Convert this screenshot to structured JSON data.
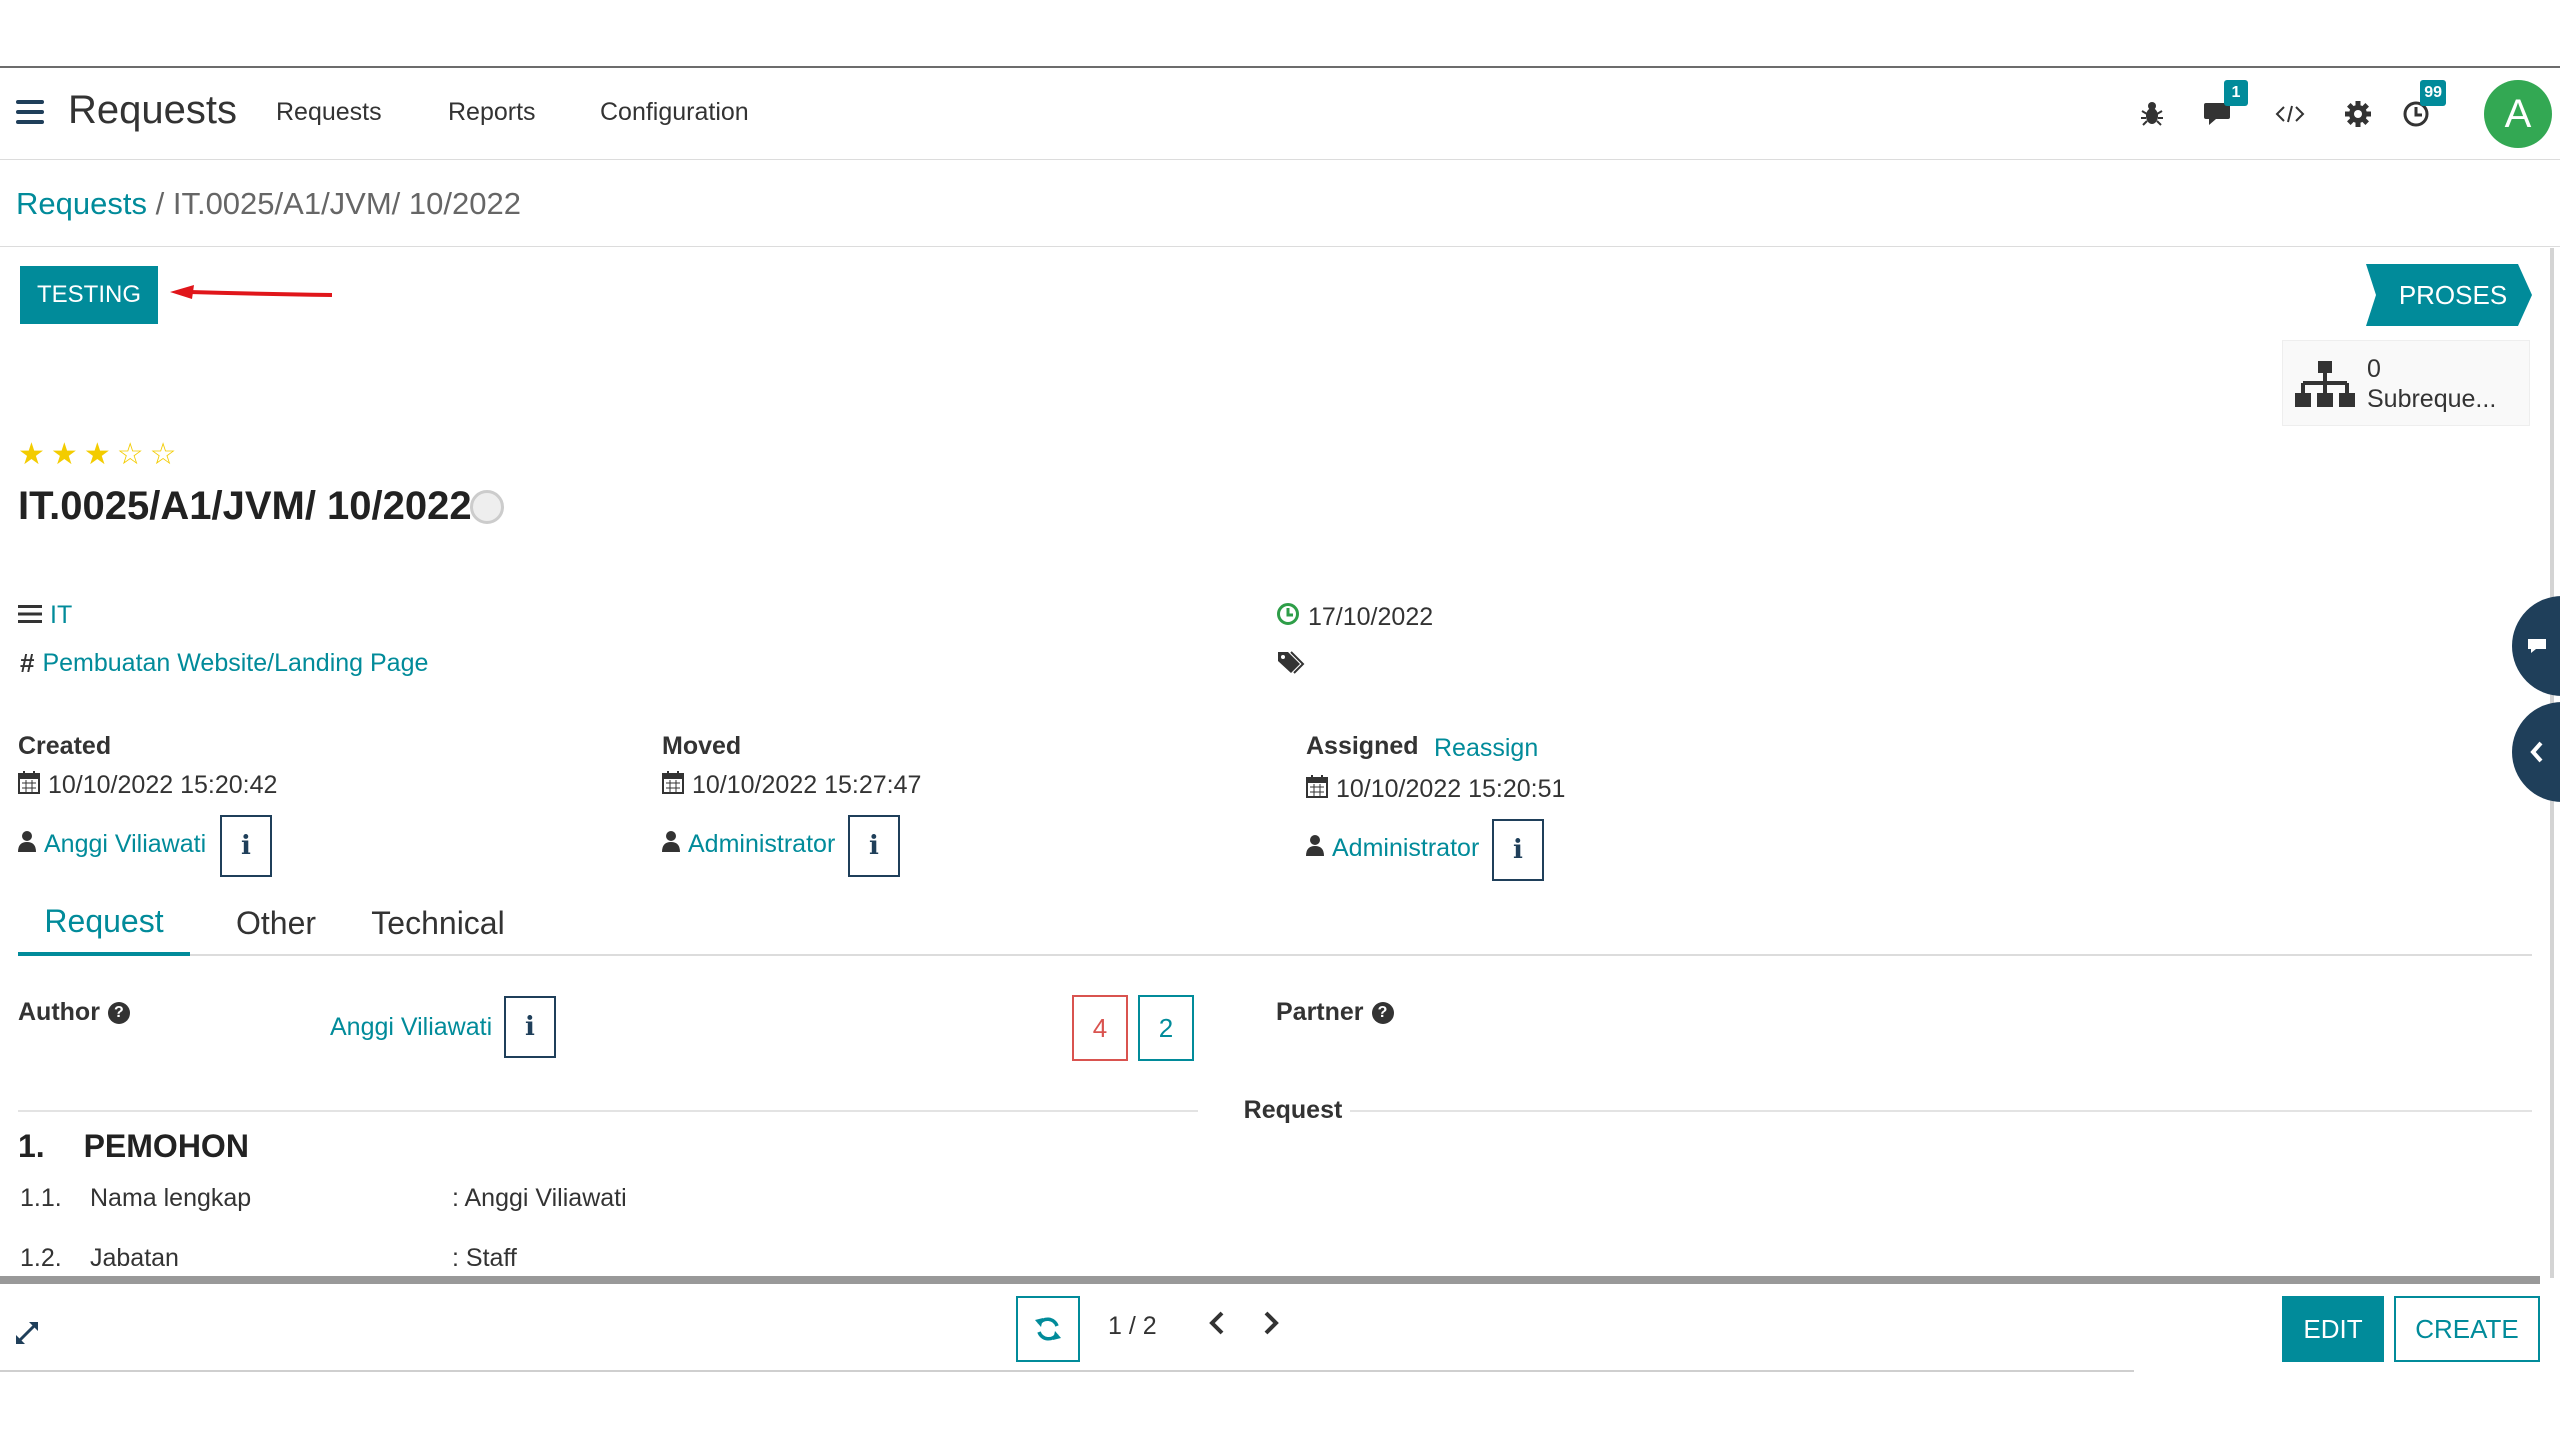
{
  "navbar": {
    "app_title": "Requests",
    "menu": [
      "Requests",
      "Reports",
      "Configuration"
    ],
    "messages_badge": "1",
    "activities_badge": "99",
    "avatar_letter": "A",
    "avatar_color": "#33a853"
  },
  "breadcrumb": {
    "parent": "Requests",
    "separator": "/",
    "current": "IT.0025/A1/JVM/ 10/2022"
  },
  "status_bar": {
    "action_button": "TESTING",
    "stage": "PROSES",
    "accent_color": "#018b9a",
    "annotation_arrow_color": "#e0161b"
  },
  "smart_button": {
    "count": "0",
    "label": "Subreque..."
  },
  "record": {
    "priority_stars": 3,
    "priority_max": 5,
    "title": "IT.0025/A1/JVM/ 10/2022",
    "category": "IT",
    "type": "Pembuatan Website/Landing Page",
    "deadline": "17/10/2022"
  },
  "tracking": {
    "created": {
      "label": "Created",
      "date": "10/10/2022 15:20:42",
      "user": "Anggi Viliawati"
    },
    "moved": {
      "label": "Moved",
      "date": "10/10/2022 15:27:47",
      "user": "Administrator"
    },
    "assigned": {
      "label": "Assigned",
      "action": "Reassign",
      "date": "10/10/2022 15:20:51",
      "user": "Administrator"
    }
  },
  "tabs": [
    "Request",
    "Other",
    "Technical"
  ],
  "active_tab": "Request",
  "request_tab": {
    "author_label": "Author",
    "author_value": "Anggi Viliawati",
    "stat_red": "4",
    "stat_teal": "2",
    "partner_label": "Partner",
    "separator_title": "Request",
    "section_number": "1.",
    "section_title": "PEMOHON",
    "rows": [
      {
        "num": "1.1.",
        "label": "Nama lengkap",
        "value": ": Anggi Viliawati"
      },
      {
        "num": "1.2.",
        "label": "Jabatan",
        "value": ": Staff"
      }
    ]
  },
  "footer": {
    "pager": "1 / 2",
    "edit_label": "EDIT",
    "create_label": "CREATE"
  }
}
